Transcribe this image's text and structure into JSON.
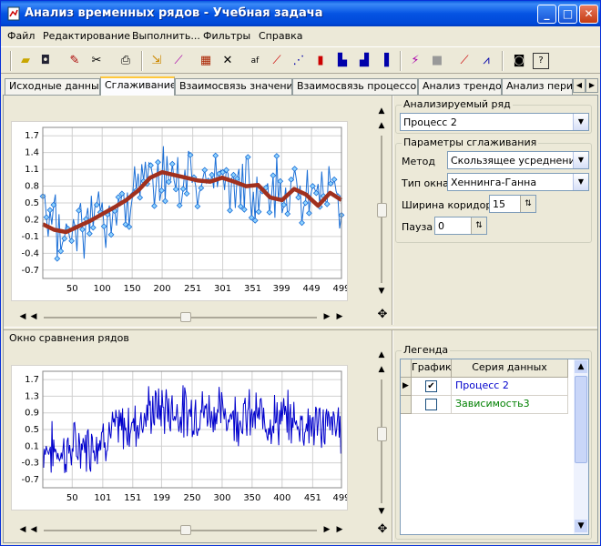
{
  "window": {
    "title": "Анализ временных рядов - Учебная задача",
    "controls": {
      "minimize": "_",
      "maximize": "□",
      "close": "✕"
    }
  },
  "menu": [
    "Файл",
    "Редактирование",
    "Выполнить...",
    "Фильтры",
    "Справка"
  ],
  "toolbar_icons": [
    "open-folder-icon",
    "save-disk-icon",
    "edit-tools-icon",
    "cut-icon",
    "print-icon",
    "import-icon",
    "chart-wizard-icon",
    "table-icon",
    "delete-icon",
    "formula-icon",
    "line-chart-icon",
    "scatter-chart-icon",
    "bar-chart-icon",
    "step-chart-icon",
    "column-chart-icon",
    "histogram-icon",
    "run-icon",
    "stop-icon",
    "trend-icon",
    "area-chart-icon",
    "camera-icon",
    "help-icon"
  ],
  "tabs": [
    "Исходные данные",
    "Сглаживание",
    "Взаимосвязь значений",
    "Взаимосвязь процессов",
    "Анализ трендов",
    "Анализ пери"
  ],
  "active_tab": 1,
  "analyzed_series": {
    "label": "Анализируемый ряд",
    "value": "Процесс 2"
  },
  "smoothing": {
    "label": "Параметры сглаживания",
    "method_label": "Метод",
    "method_value": "Скользящее усреднение",
    "window_label": "Тип окна",
    "window_value": "Хеннинга-Ганна",
    "width_label": "Ширина коридора",
    "width_value": "15",
    "pause_label": "Пауза",
    "pause_value": "0"
  },
  "comparison_label": "Окно сравнения рядов",
  "legend": {
    "label": "Легенда",
    "col_graph": "График",
    "col_series": "Серия данных",
    "rows": [
      {
        "name": "Процесс 2",
        "checked": true,
        "color": "#0000cc"
      },
      {
        "name": "Зависимость3",
        "checked": false,
        "color": "#008000"
      }
    ]
  },
  "chart_data": [
    {
      "type": "line",
      "title": "",
      "x_ticks": [
        "50",
        "100",
        "150",
        "200",
        "251",
        "301",
        "351",
        "399",
        "449",
        "499"
      ],
      "y_ticks": [
        "1.7",
        "1.4",
        "1.1",
        "0.8",
        "0.5",
        "0.2",
        "-0.1",
        "-0.4",
        "-0.7"
      ],
      "xlim": [
        1,
        499
      ],
      "ylim": [
        -0.85,
        1.85
      ],
      "grid": true,
      "series": [
        {
          "role": "raw",
          "color": "#1c6fd6",
          "marker_fill": "#8fd3ff",
          "x": [
            1,
            20,
            40,
            60,
            80,
            100,
            120,
            140,
            160,
            180,
            200,
            220,
            240,
            260,
            280,
            300,
            320,
            340,
            360,
            380,
            400,
            420,
            440,
            460,
            480,
            499
          ],
          "y": [
            0.1,
            0.0,
            -0.05,
            0.1,
            0.15,
            0.35,
            0.45,
            0.55,
            0.7,
            0.95,
            1.0,
            0.95,
            0.9,
            0.95,
            0.95,
            0.9,
            0.85,
            0.8,
            0.8,
            0.75,
            0.75,
            0.7,
            0.65,
            0.6,
            0.6,
            0.55
          ]
        },
        {
          "role": "smoothed",
          "color": "#a0301e",
          "x": [
            1,
            20,
            40,
            60,
            80,
            100,
            120,
            140,
            160,
            180,
            200,
            220,
            240,
            260,
            280,
            300,
            320,
            340,
            360,
            380,
            400,
            420,
            440,
            460,
            480,
            499
          ],
          "y": [
            0.12,
            0.02,
            -0.02,
            0.08,
            0.18,
            0.3,
            0.42,
            0.55,
            0.72,
            0.95,
            1.05,
            1.0,
            0.95,
            0.9,
            0.88,
            0.95,
            0.88,
            0.8,
            0.82,
            0.6,
            0.55,
            0.75,
            0.65,
            0.45,
            0.68,
            0.55
          ]
        }
      ]
    },
    {
      "type": "line",
      "title": "",
      "x_ticks": [
        "50",
        "101",
        "151",
        "199",
        "250",
        "300",
        "350",
        "400",
        "451",
        "499"
      ],
      "y_ticks": [
        "1.7",
        "1.3",
        "0.9",
        "0.5",
        "0.1",
        "-0.3",
        "-0.7"
      ],
      "xlim": [
        1,
        499
      ],
      "ylim": [
        -0.9,
        1.9
      ],
      "grid": true,
      "series": [
        {
          "name": "Процесс 2",
          "color": "#0000cc",
          "x": [
            1,
            20,
            40,
            60,
            80,
            100,
            120,
            140,
            160,
            180,
            200,
            220,
            240,
            260,
            280,
            300,
            320,
            340,
            360,
            380,
            400,
            420,
            440,
            460,
            480,
            499
          ],
          "y": [
            0.1,
            0.0,
            -0.05,
            0.1,
            0.15,
            0.35,
            0.45,
            0.55,
            0.7,
            0.95,
            1.0,
            0.95,
            0.9,
            0.95,
            0.95,
            0.9,
            0.85,
            0.8,
            0.8,
            0.75,
            0.75,
            0.7,
            0.65,
            0.6,
            0.6,
            0.55
          ]
        }
      ]
    }
  ]
}
